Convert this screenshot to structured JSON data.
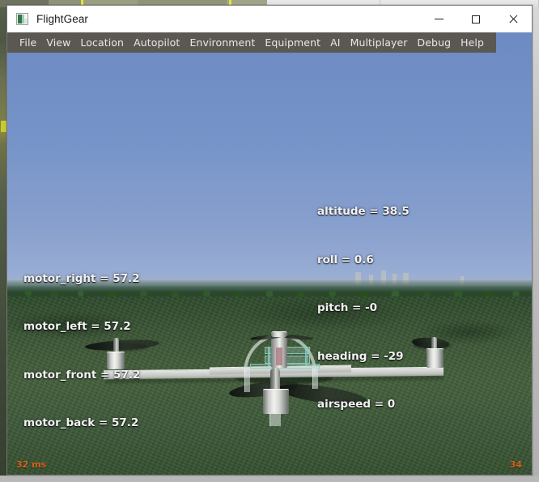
{
  "window": {
    "title": "FlightGear",
    "icon": "flightgear-app-icon",
    "controls": {
      "minimize": "minimize-button",
      "maximize": "maximize-button",
      "close": "close-button"
    }
  },
  "menubar": {
    "items": [
      {
        "label": "File"
      },
      {
        "label": "View"
      },
      {
        "label": "Location"
      },
      {
        "label": "Autopilot"
      },
      {
        "label": "Environment"
      },
      {
        "label": "Equipment"
      },
      {
        "label": "AI"
      },
      {
        "label": "Multiplayer"
      },
      {
        "label": "Debug"
      },
      {
        "label": "Help"
      }
    ]
  },
  "hud": {
    "motors": [
      "motor_right = 57.2",
      "motor_left = 57.2",
      "motor_front = 57.2",
      "motor_back = 57.2"
    ],
    "flight": [
      "altitude = 38.5",
      "roll = 0.6",
      "pitch = -0",
      "heading = -29",
      "airspeed = 0"
    ],
    "frame_time": "32 ms",
    "fps": "34"
  },
  "scene": {
    "vehicle": "quadcopter-drone",
    "terrain": "grass-field",
    "sky_top_color": "#6d8bc3",
    "sky_horizon_color": "#a7b8d6",
    "ground_color": "#3c5636",
    "hud_text_color": "#f2f2f2",
    "hud_accent_color": "#d4631c",
    "menubar_color": "#5b5853"
  }
}
